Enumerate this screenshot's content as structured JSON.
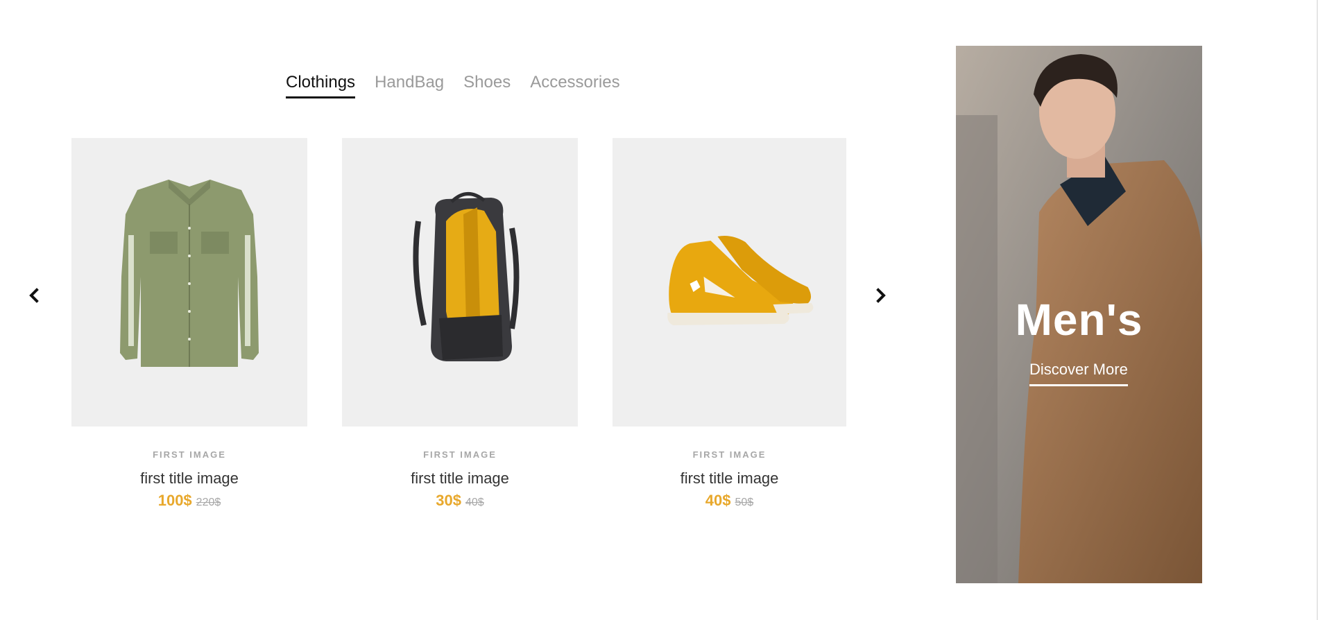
{
  "tabs": [
    {
      "label": "Clothings",
      "active": true
    },
    {
      "label": "HandBag",
      "active": false
    },
    {
      "label": "Shoes",
      "active": false
    },
    {
      "label": "Accessories",
      "active": false
    }
  ],
  "carousel": {
    "prev_icon": "chevron-left-icon",
    "next_icon": "chevron-right-icon"
  },
  "products": [
    {
      "subtitle": "FIRST IMAGE",
      "title": "first title image",
      "price": "100$",
      "old_price": "220$",
      "image": "green-shirt"
    },
    {
      "subtitle": "FIRST IMAGE",
      "title": "first title image",
      "price": "30$",
      "old_price": "40$",
      "image": "yellow-backpack"
    },
    {
      "subtitle": "FIRST IMAGE",
      "title": "first title image",
      "price": "40$",
      "old_price": "50$",
      "image": "yellow-sneakers"
    }
  ],
  "banner": {
    "heading": "Men's",
    "cta": "Discover More",
    "image": "man-in-camel-coat"
  },
  "colors": {
    "accent": "#e8a82c",
    "muted": "#a7a7a7",
    "card_bg": "#efefef"
  }
}
